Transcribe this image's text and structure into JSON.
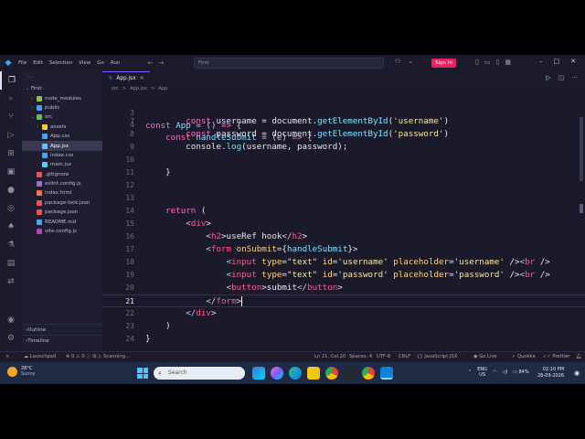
{
  "titlebar": {
    "menu": [
      "File",
      "Edit",
      "Selection",
      "View",
      "Go",
      "Run"
    ],
    "search_text": "First",
    "signin_label": "Sign In"
  },
  "sidebar": {
    "root": "First",
    "items": [
      {
        "label": "node_modules",
        "depth": 1,
        "type": "folder",
        "color": "#8bc34a"
      },
      {
        "label": "public",
        "depth": 1,
        "type": "folder",
        "color": "#42a5f5"
      },
      {
        "label": "src",
        "depth": 1,
        "type": "folder-open",
        "color": "#66bb6a"
      },
      {
        "label": "assets",
        "depth": 2,
        "type": "folder",
        "color": "#ffca28"
      },
      {
        "label": "App.css",
        "depth": 2,
        "type": "file",
        "color": "#42a5f5"
      },
      {
        "label": "App.jsx",
        "depth": 2,
        "type": "file",
        "color": "#5ac8fa",
        "selected": true
      },
      {
        "label": "index.css",
        "depth": 2,
        "type": "file",
        "color": "#42a5f5"
      },
      {
        "label": "main.jsx",
        "depth": 2,
        "type": "file",
        "color": "#5ac8fa"
      },
      {
        "label": ".gitignore",
        "depth": 1,
        "type": "file",
        "color": "#ef5350"
      },
      {
        "label": "eslint.config.js",
        "depth": 1,
        "type": "file",
        "color": "#9575cd"
      },
      {
        "label": "index.html",
        "depth": 1,
        "type": "file",
        "color": "#ff7043"
      },
      {
        "label": "package-lock.json",
        "depth": 1,
        "type": "file",
        "color": "#ef5350"
      },
      {
        "label": "package.json",
        "depth": 1,
        "type": "file",
        "color": "#ef5350"
      },
      {
        "label": "README.md",
        "depth": 1,
        "type": "file",
        "color": "#42a5f5"
      },
      {
        "label": "vite.config.js",
        "depth": 1,
        "type": "file",
        "color": "#ab47bc"
      }
    ],
    "outline_label": "Outline",
    "timeline_label": "Timeline"
  },
  "editor": {
    "tab_label": "App.jsx",
    "breadcrumb": [
      "src",
      ">",
      "App.jsx",
      ">",
      "App"
    ],
    "sticky_line": {
      "num": "3",
      "text": "const App = () => {"
    },
    "sticky_line2": {
      "num": "4",
      "text": "const handleSubmit = (e) => {"
    },
    "lines": [
      {
        "num": "7",
        "text": "        const username = document.getElementById('username')"
      },
      {
        "num": "8",
        "text": "        const password = document.getElementById('password')"
      },
      {
        "num": "9",
        "text": "        console.log(username, password);"
      },
      {
        "num": "10",
        "text": ""
      },
      {
        "num": "11",
        "text": "    }"
      },
      {
        "num": "12",
        "text": ""
      },
      {
        "num": "13",
        "text": ""
      },
      {
        "num": "14",
        "text": "    return ("
      },
      {
        "num": "15",
        "text": "        <div>"
      },
      {
        "num": "16",
        "text": "            <h2>useRef hook</h2>"
      },
      {
        "num": "17",
        "text": "            <form onSubmit={handleSubmit}>"
      },
      {
        "num": "18",
        "text": "                <input type=\"text\" id='username' placeholder='username' /><br />"
      },
      {
        "num": "19",
        "text": "                <input type=\"text\" id='password' placeholder='password' /><br />"
      },
      {
        "num": "20",
        "text": "                <button>submit</button>"
      },
      {
        "num": "21",
        "text": "            </form>"
      },
      {
        "num": "22",
        "text": "        </div>"
      },
      {
        "num": "23",
        "text": "    )"
      },
      {
        "num": "24",
        "text": "}"
      }
    ],
    "current_line": "21"
  },
  "statusbar": {
    "launchpad": "Launchpad",
    "errors": "0",
    "warnings": "0",
    "info": "0",
    "scanning": "(.): Scanning...",
    "position": "Ln 21, Col 20",
    "spaces": "Spaces: 4",
    "encoding": "UTF-8",
    "eol": "CRLF",
    "language": "JavaScript JSX",
    "golive": "Go Live",
    "quokka": "Quokka",
    "prettier": "Prettier"
  },
  "taskbar": {
    "temp": "28°C",
    "weather": "Sunny",
    "search_placeholder": "Search",
    "lang1": "ENG",
    "lang2": "US",
    "battery": "84%",
    "time": "02:10 PM",
    "date": "28-09-2026"
  }
}
